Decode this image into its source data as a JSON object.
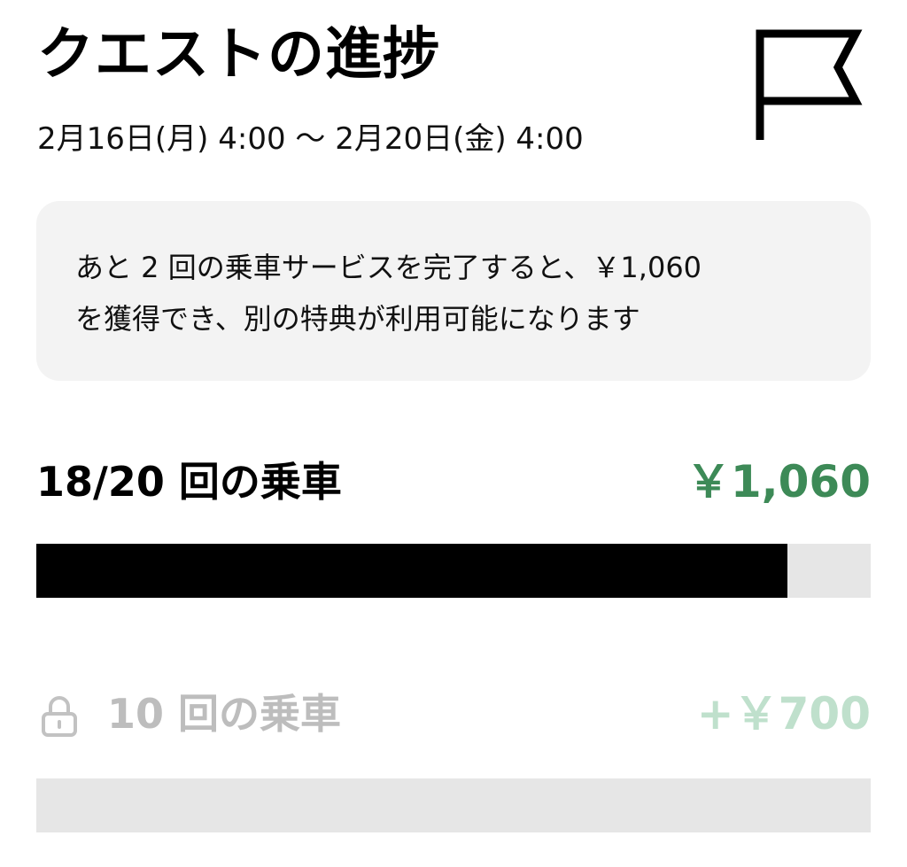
{
  "header": {
    "title": "クエストの進捗",
    "flag_icon": "flag-icon",
    "date_range": "2月16日(月) 4:00 〜 2月20日(金) 4:00"
  },
  "info_card": {
    "line1": "あと 2 回の乗車サービスを完了すると、￥1,060",
    "line2": "を獲得でき、別の特典が利用可能になります"
  },
  "tiers": [
    {
      "label": "18/20 回の乗車",
      "reward": "￥1,060",
      "progress": 0.9,
      "locked": false,
      "reward_color": "#3d8a57"
    },
    {
      "label": "10 回の乗車",
      "reward": "+￥700",
      "progress": 0,
      "locked": true,
      "lock_icon": "lock-icon",
      "reward_color": "#bfe0cc"
    }
  ]
}
